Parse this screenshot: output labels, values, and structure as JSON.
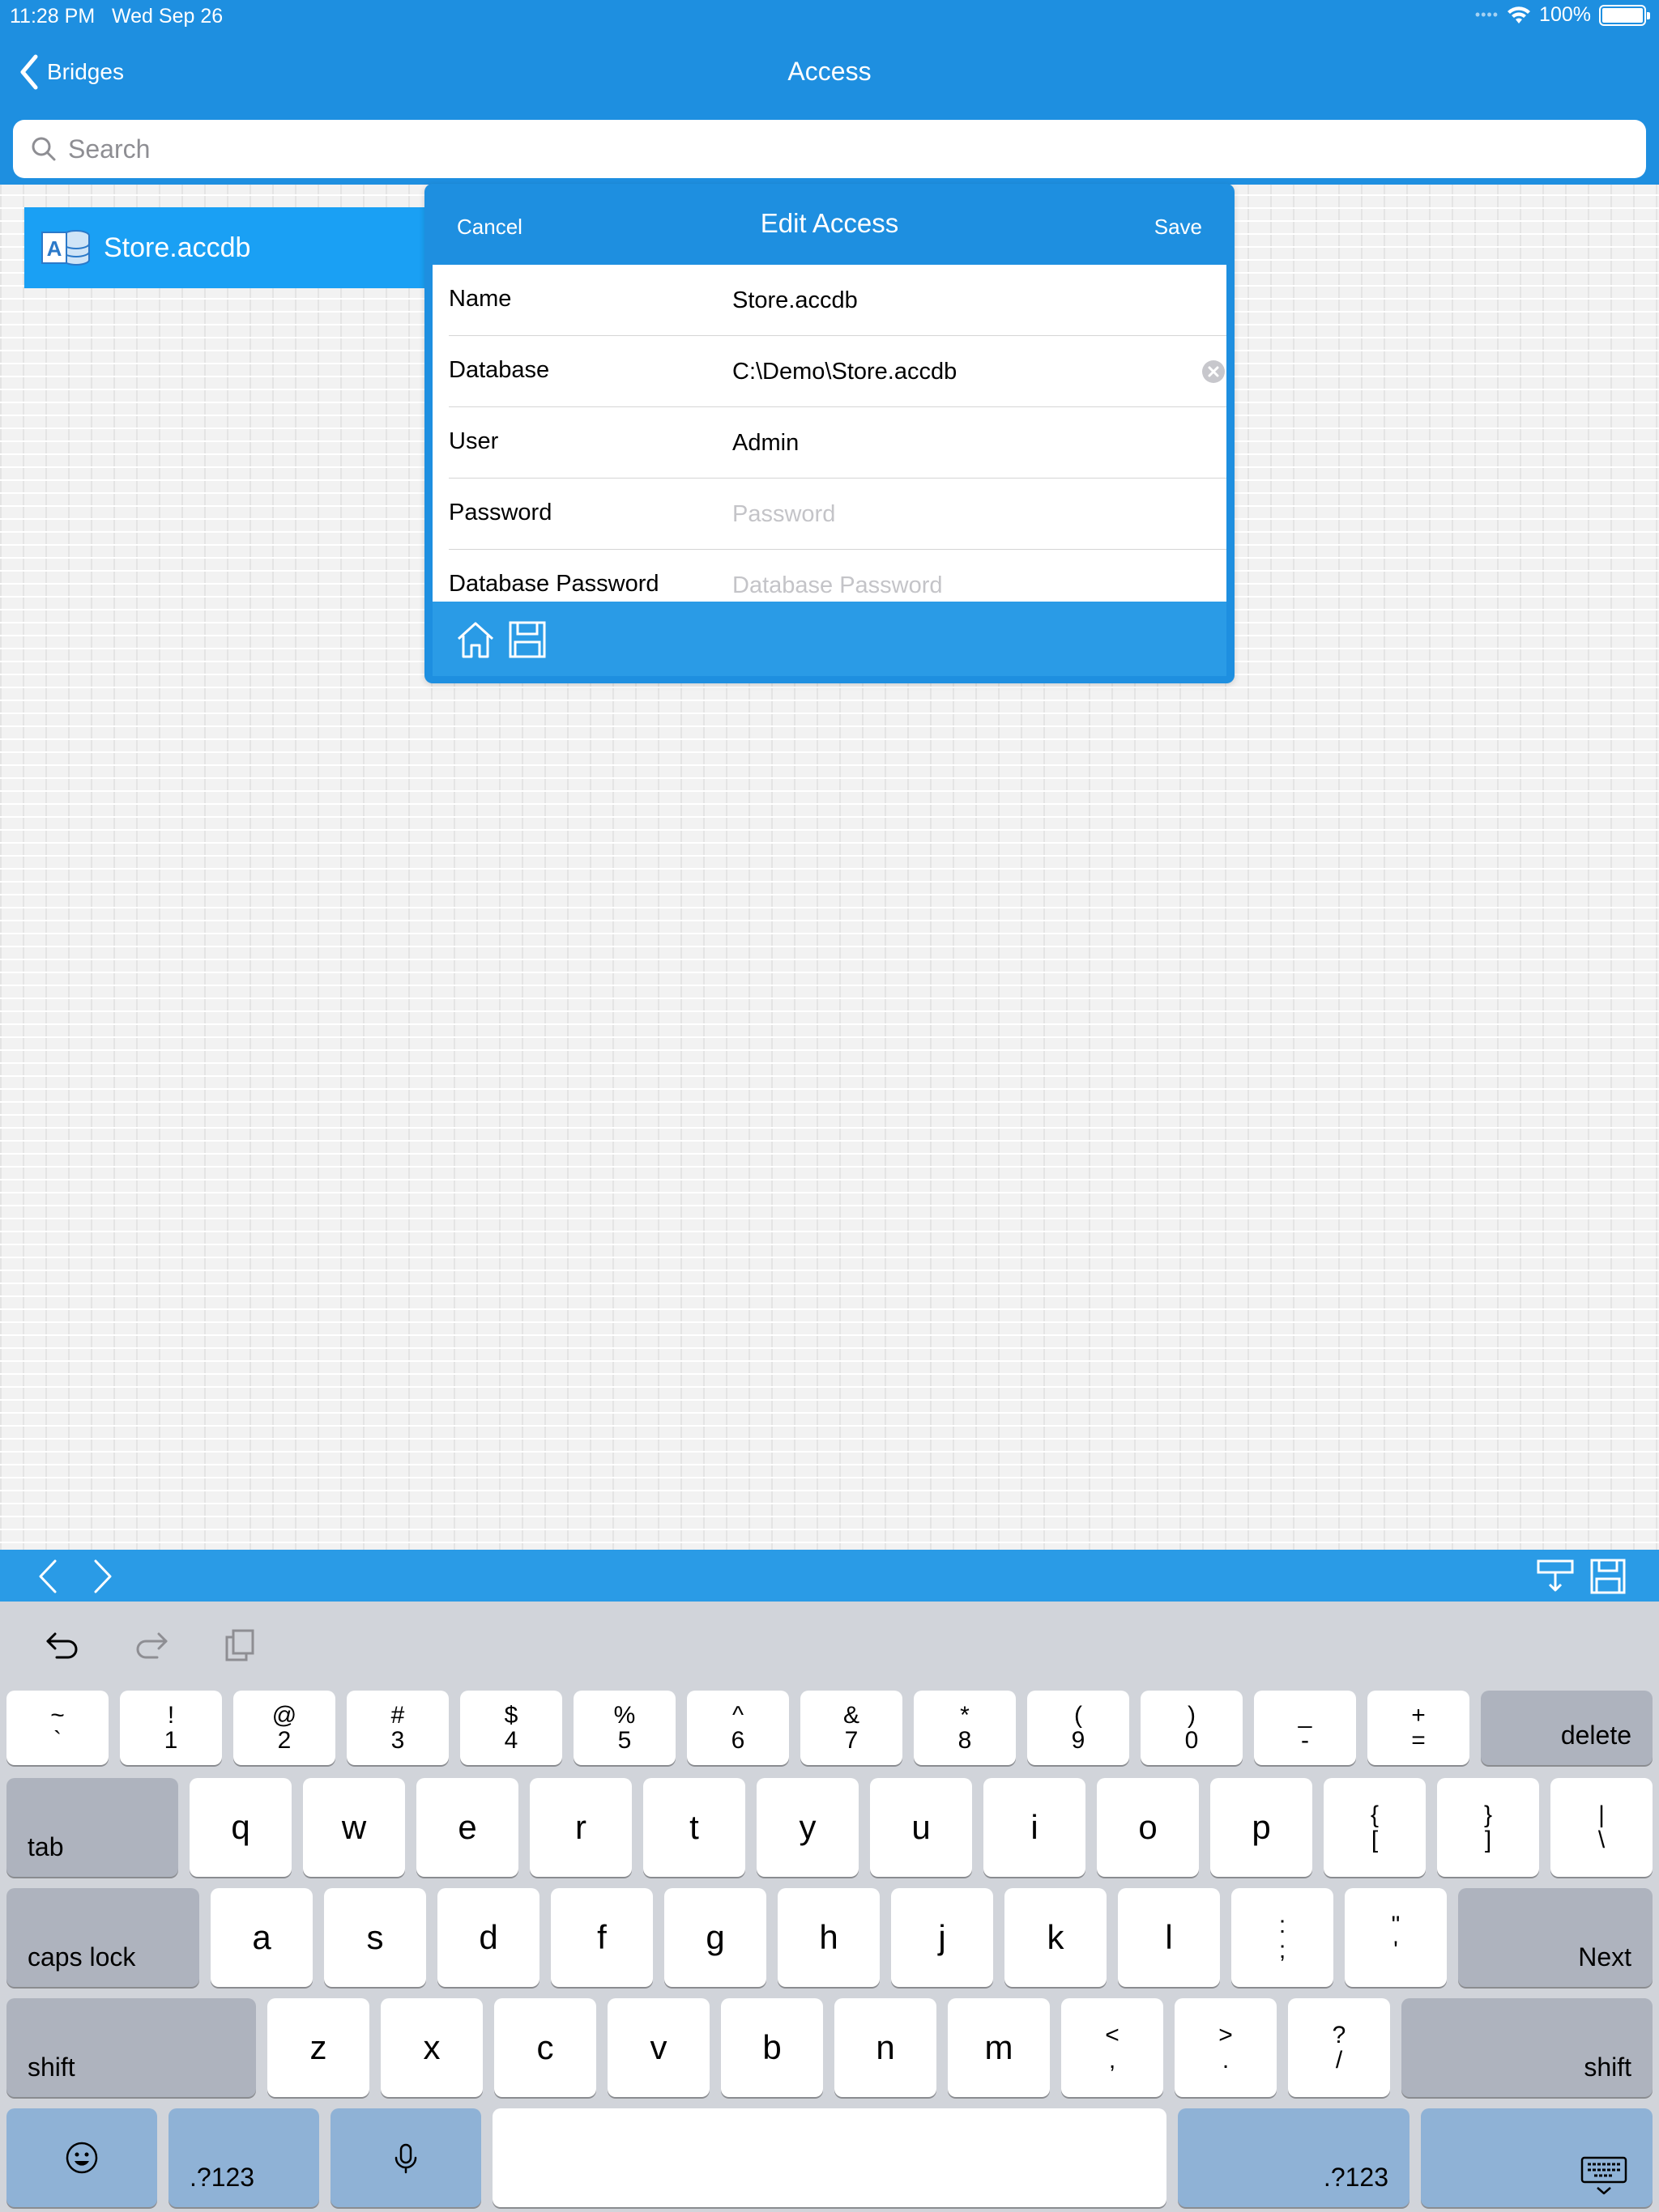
{
  "status_bar": {
    "time": "11:28 PM",
    "date": "Wed Sep 26",
    "battery": "100%",
    "icons": [
      "cellular-dots-icon",
      "wifi-icon",
      "battery-icon"
    ]
  },
  "nav": {
    "back_label": "Bridges",
    "title": "Access"
  },
  "search": {
    "placeholder": "Search",
    "value": ""
  },
  "list": {
    "items": [
      {
        "label": "Store.accdb",
        "icon": "access-database-icon",
        "selected": true
      }
    ]
  },
  "dialog": {
    "title": "Edit Access",
    "cancel_label": "Cancel",
    "save_label": "Save",
    "fields": [
      {
        "label": "Name",
        "value": "Store.accdb",
        "placeholder": ""
      },
      {
        "label": "Database",
        "value": "C:\\Demo\\Store.accdb",
        "placeholder": ""
      },
      {
        "label": "User",
        "value": "Admin",
        "placeholder": ""
      },
      {
        "label": "Password",
        "value": "",
        "placeholder": "Password"
      },
      {
        "label": "Database Password",
        "value": "",
        "placeholder": "Database Password"
      }
    ],
    "toolbar_icons": [
      "home-icon",
      "save-floppy-icon"
    ]
  },
  "accessory_bar": {
    "icons": [
      "previous-field-icon",
      "next-field-icon",
      "hide-keyboard-icon",
      "save-floppy-icon"
    ]
  },
  "keyboard": {
    "assistant_icons": [
      "undo-icon",
      "redo-icon",
      "paste-icon"
    ],
    "row1": [
      {
        "top": "~",
        "bot": "`"
      },
      {
        "top": "!",
        "bot": "1"
      },
      {
        "top": "@",
        "bot": "2"
      },
      {
        "top": "#",
        "bot": "3"
      },
      {
        "top": "$",
        "bot": "4"
      },
      {
        "top": "%",
        "bot": "5"
      },
      {
        "top": "^",
        "bot": "6"
      },
      {
        "top": "&",
        "bot": "7"
      },
      {
        "top": "*",
        "bot": "8"
      },
      {
        "top": "(",
        "bot": "9"
      },
      {
        "top": ")",
        "bot": "0"
      },
      {
        "top": "_",
        "bot": "-"
      },
      {
        "top": "+",
        "bot": "="
      }
    ],
    "delete_label": "delete",
    "tab_label": "tab",
    "row2": [
      "q",
      "w",
      "e",
      "r",
      "t",
      "y",
      "u",
      "i",
      "o",
      "p"
    ],
    "row2_symbols": [
      {
        "top": "{",
        "bot": "["
      },
      {
        "top": "}",
        "bot": "]"
      },
      {
        "top": "|",
        "bot": "\\"
      }
    ],
    "caps_label": "caps lock",
    "row3": [
      "a",
      "s",
      "d",
      "f",
      "g",
      "h",
      "j",
      "k",
      "l"
    ],
    "row3_symbols": [
      {
        "top": ":",
        "bot": ";"
      },
      {
        "top": "\"",
        "bot": "'"
      }
    ],
    "next_label": "Next",
    "shift_label": "shift",
    "row4": [
      "z",
      "x",
      "c",
      "v",
      "b",
      "n",
      "m"
    ],
    "row4_symbols": [
      {
        "top": "<",
        "bot": ","
      },
      {
        "top": ">",
        "bot": "."
      },
      {
        "top": "?",
        "bot": "/"
      }
    ],
    "numbers_label": ".?123",
    "bottom_icons": [
      "emoji-icon",
      "microphone-icon",
      "keyboard-dismiss-icon"
    ]
  },
  "colors": {
    "brand_blue": "#1e8fe0",
    "selected_item": "#1aa0f4",
    "keyboard_bg": "#d1d4da"
  }
}
